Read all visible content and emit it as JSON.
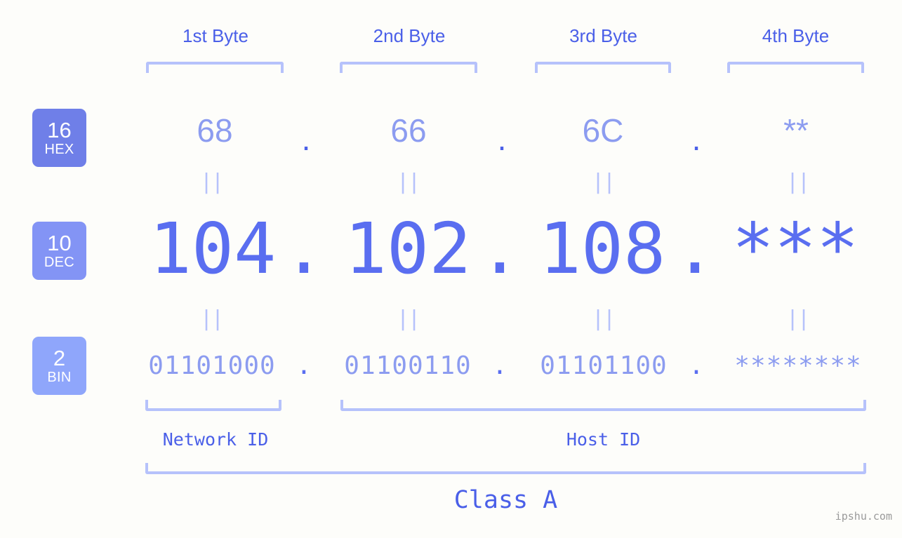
{
  "page": {
    "background_color": "#fdfdfa",
    "watermark": "ipshu.com"
  },
  "colors": {
    "accent_strong": "#4a5fe8",
    "accent_mid": "#5a6ef0",
    "accent_light": "#8c9cf0",
    "bracket": "#b6c2fb",
    "badge_hex": "#6f7fe8",
    "badge_dec": "#8394f5",
    "badge_bin": "#8fa6fb",
    "badge_text": "#ffffff",
    "watermark_text": "#9a9a9a"
  },
  "byte_headers": [
    {
      "label": "1st Byte"
    },
    {
      "label": "2nd Byte"
    },
    {
      "label": "3rd Byte"
    },
    {
      "label": "4th Byte"
    }
  ],
  "radix_badges": [
    {
      "number": "16",
      "label": "HEX"
    },
    {
      "number": "10",
      "label": "DEC"
    },
    {
      "number": "2",
      "label": "BIN"
    }
  ],
  "rows": {
    "hex": {
      "radix": "16",
      "radix_label": "HEX",
      "values": [
        "68",
        "66",
        "6C",
        "**"
      ],
      "separators": [
        ".",
        ".",
        "."
      ]
    },
    "dec": {
      "radix": "10",
      "radix_label": "DEC",
      "values": [
        "104",
        "102",
        "108",
        "***"
      ],
      "separators": [
        ".",
        ".",
        "."
      ]
    },
    "bin": {
      "radix": "2",
      "radix_label": "BIN",
      "values": [
        "01101000",
        "01100110",
        "01101100",
        "********"
      ],
      "separators": [
        ".",
        ".",
        "."
      ]
    }
  },
  "equality_marks": {
    "glyph": "||",
    "count_per_row": 4,
    "rows": 2
  },
  "segments": {
    "network_id": {
      "label": "Network ID"
    },
    "host_id": {
      "label": "Host ID"
    },
    "class": {
      "label": "Class A"
    }
  }
}
